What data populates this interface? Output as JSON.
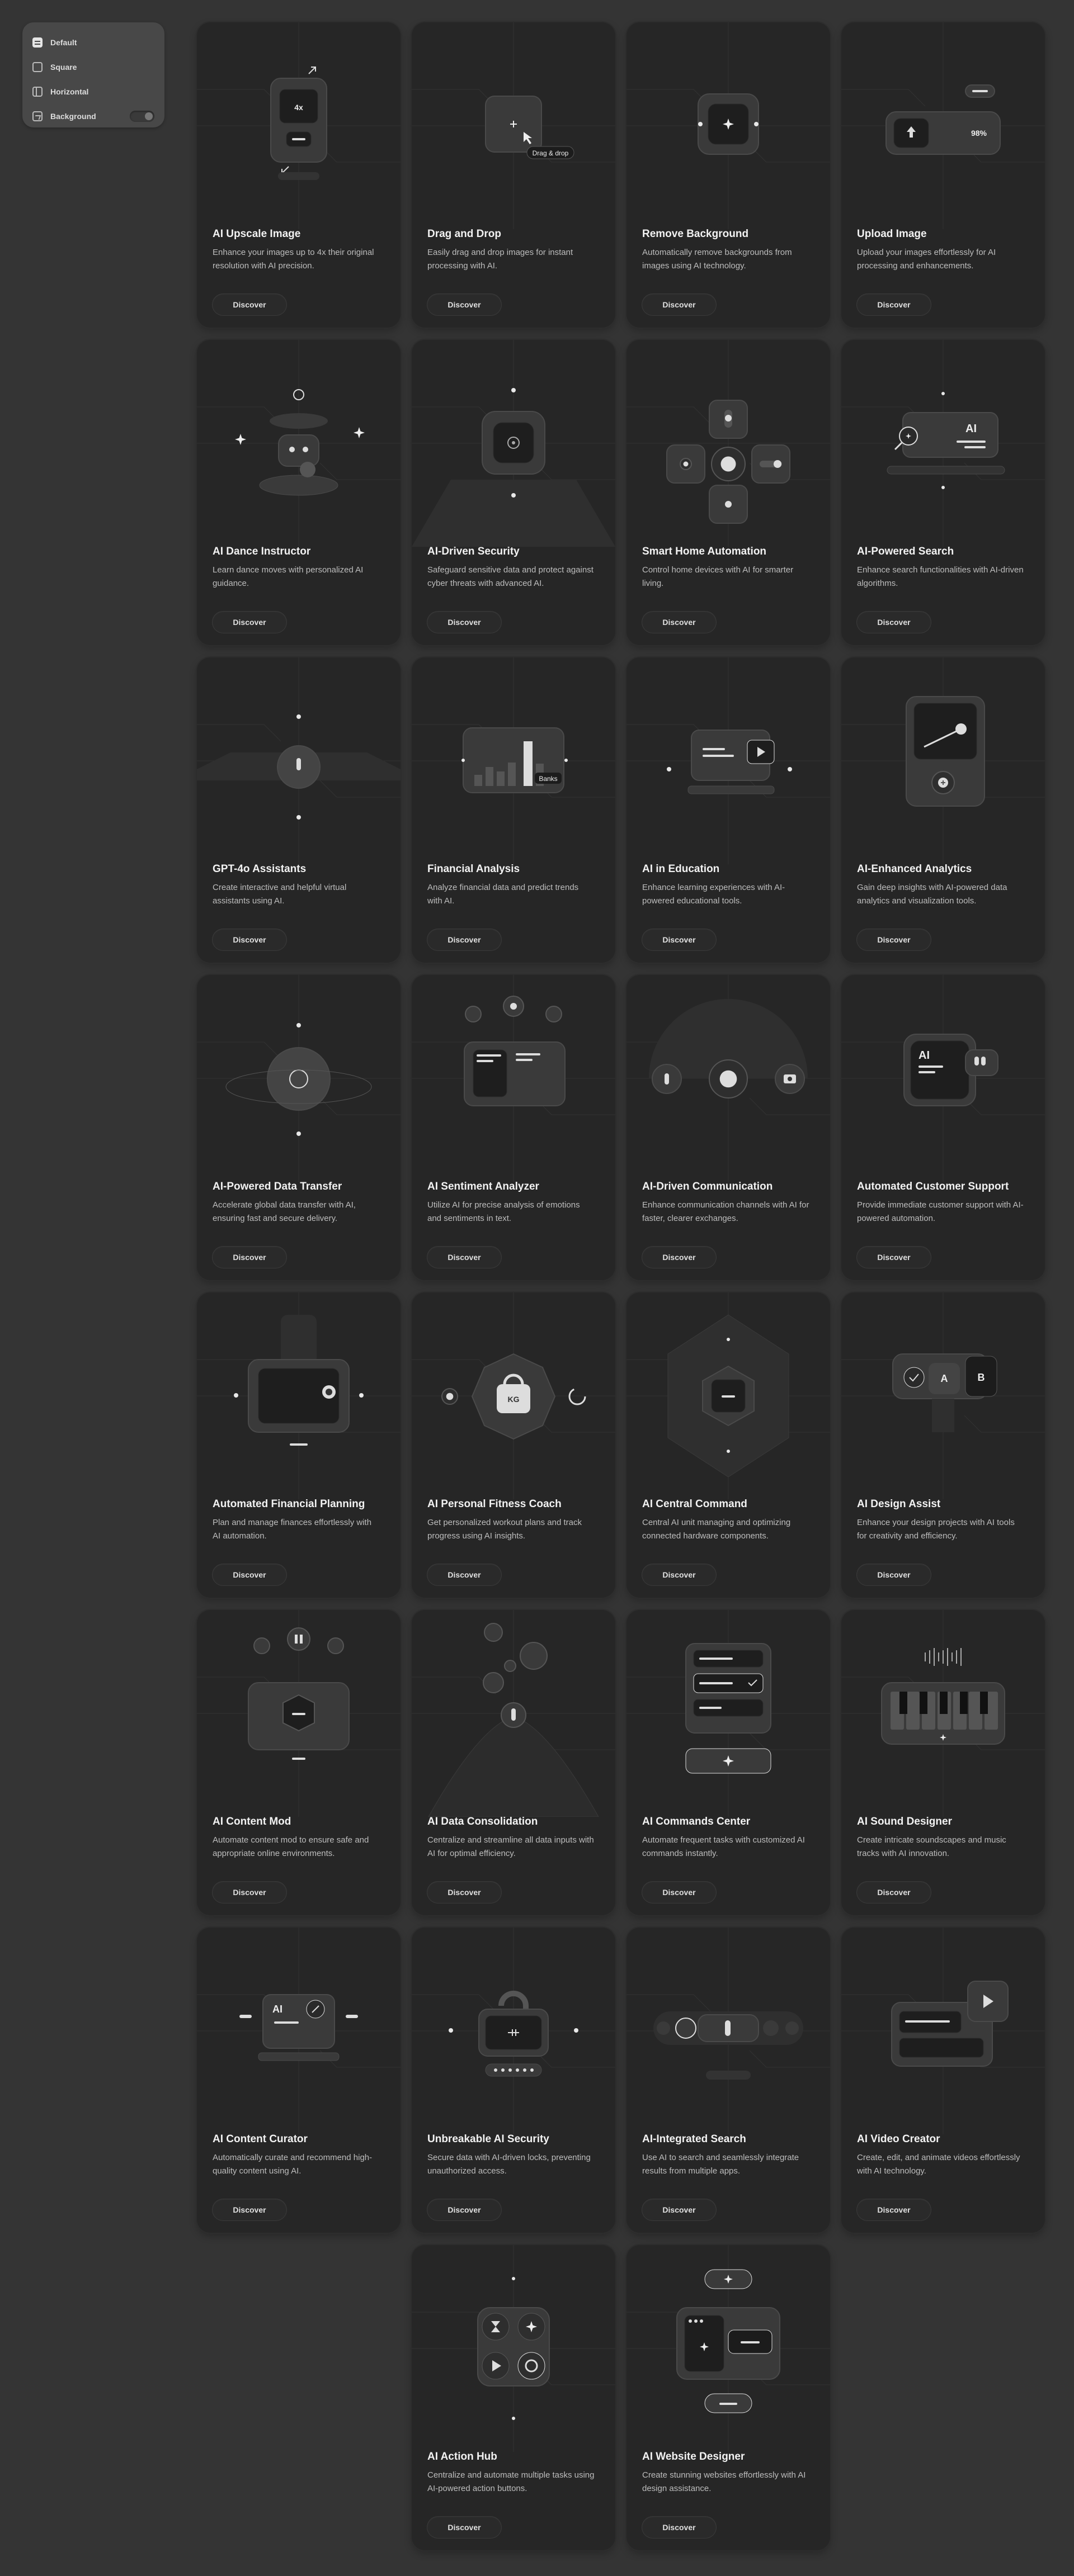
{
  "layout_options": [
    {
      "label": "Default",
      "icon": "list-icon",
      "active": true
    },
    {
      "label": "Square",
      "icon": "square-icon",
      "active": false
    },
    {
      "label": "Horizontal",
      "icon": "horizontal-layout-icon",
      "active": false
    },
    {
      "label": "Background",
      "icon": "image-icon",
      "active": false,
      "toggle": "off"
    }
  ],
  "colors": {
    "page_bg": "#343434",
    "card_bg": "#262626",
    "panel_bg": "#484848",
    "text": "#f2f2f2",
    "muted": "#bdbdbd"
  },
  "cards": [
    {
      "title": "AI Upscale Image",
      "description": "Enhance your images up to 4x their original resolution with AI precision.",
      "button": "Discover",
      "art": "upscale",
      "labels": [
        "4x"
      ]
    },
    {
      "title": "Drag and Drop",
      "description": "Easily drag and drop images for instant processing with AI.",
      "button": "Discover",
      "art": "dragdrop",
      "labels": [
        "Drag & drop"
      ]
    },
    {
      "title": "Remove Background",
      "description": "Automatically remove backgrounds from images using AI technology.",
      "button": "Discover",
      "art": "removebg",
      "labels": []
    },
    {
      "title": "Upload Image",
      "description": "Upload your images effortlessly for AI processing and enhancements.",
      "button": "Discover",
      "art": "upload",
      "labels": [
        "98%"
      ]
    },
    {
      "title": "AI Dance Instructor",
      "description": "Learn dance moves with personalized AI guidance.",
      "button": "Discover",
      "art": "dance",
      "labels": []
    },
    {
      "title": "AI-Driven Security",
      "description": "Safeguard sensitive data and protect against cyber threats with advanced AI.",
      "button": "Discover",
      "art": "security",
      "labels": []
    },
    {
      "title": "Smart Home Automation",
      "description": "Control home devices with AI for smarter living.",
      "button": "Discover",
      "art": "smarthome",
      "labels": []
    },
    {
      "title": "AI-Powered Search",
      "description": "Enhance search functionalities with AI-driven algorithms.",
      "button": "Discover",
      "art": "search",
      "labels": [
        "AI"
      ]
    },
    {
      "title": "GPT-4o Assistants",
      "description": "Create interactive and helpful virtual assistants using AI.",
      "button": "Discover",
      "art": "gpt",
      "labels": []
    },
    {
      "title": "Financial Analysis",
      "description": "Analyze financial data and predict trends with AI.",
      "button": "Discover",
      "art": "finance",
      "labels": [
        "Banks"
      ]
    },
    {
      "title": "AI in Education",
      "description": "Enhance learning experiences with AI-powered educational tools.",
      "button": "Discover",
      "art": "education",
      "labels": []
    },
    {
      "title": "AI-Enhanced Analytics",
      "description": "Gain deep insights with AI-powered data analytics and visualization tools.",
      "button": "Discover",
      "art": "analytics",
      "labels": []
    },
    {
      "title": "AI-Powered Data Transfer",
      "description": "Accelerate global data transfer with AI, ensuring fast and secure delivery.",
      "button": "Discover",
      "art": "transfer",
      "labels": []
    },
    {
      "title": "AI Sentiment Analyzer",
      "description": "Utilize AI for precise analysis of emotions and sentiments in text.",
      "button": "Discover",
      "art": "sentiment",
      "labels": []
    },
    {
      "title": "AI-Driven Communication",
      "description": "Enhance communication channels with AI for faster, clearer exchanges.",
      "button": "Discover",
      "art": "communication",
      "labels": []
    },
    {
      "title": "Automated Customer Support",
      "description": "Provide immediate customer support with AI-powered automation.",
      "button": "Discover",
      "art": "support",
      "labels": [
        "AI"
      ]
    },
    {
      "title": "Automated Financial Planning",
      "description": "Plan and manage finances effortlessly with AI automation.",
      "button": "Discover",
      "art": "planning",
      "labels": []
    },
    {
      "title": "AI Personal Fitness Coach",
      "description": "Get personalized workout plans and track progress using AI insights.",
      "button": "Discover",
      "art": "fitness",
      "labels": [
        "KG"
      ]
    },
    {
      "title": "AI Central Command",
      "description": "Central AI unit managing and optimizing connected hardware components.",
      "button": "Discover",
      "art": "central",
      "labels": []
    },
    {
      "title": "AI Design Assist",
      "description": "Enhance your design projects with AI tools for creativity and efficiency.",
      "button": "Discover",
      "art": "design",
      "labels": [
        "A",
        "B"
      ]
    },
    {
      "title": "AI Content Mod",
      "description": "Automate content mod to ensure safe and appropriate online environments.",
      "button": "Discover",
      "art": "contentmod",
      "labels": []
    },
    {
      "title": "AI Data Consolidation",
      "description": "Centralize and streamline all data inputs with AI for optimal efficiency.",
      "button": "Discover",
      "art": "consolidation",
      "labels": []
    },
    {
      "title": "AI Commands Center",
      "description": "Automate frequent tasks with customized AI commands instantly.",
      "button": "Discover",
      "art": "commands",
      "labels": []
    },
    {
      "title": "AI Sound Designer",
      "description": "Create intricate soundscapes and music tracks with AI innovation.",
      "button": "Discover",
      "art": "sound",
      "labels": []
    },
    {
      "title": "AI Content Curator",
      "description": "Automatically curate and recommend high-quality content using AI.",
      "button": "Discover",
      "art": "curator",
      "labels": [
        "AI"
      ]
    },
    {
      "title": "Unbreakable AI Security",
      "description": "Secure data with AI-driven locks, preventing unauthorized access.",
      "button": "Discover",
      "art": "lock",
      "labels": []
    },
    {
      "title": "AI-Integrated Search",
      "description": "Use AI to search and seamlessly integrate results from multiple apps.",
      "button": "Discover",
      "art": "integrated",
      "labels": []
    },
    {
      "title": "AI Video Creator",
      "description": "Create, edit, and animate videos effortlessly with AI technology.",
      "button": "Discover",
      "art": "video",
      "labels": []
    },
    {
      "title": "AI Action Hub",
      "description": "Centralize and automate multiple tasks using AI-powered action buttons.",
      "button": "Discover",
      "art": "actionhub",
      "labels": []
    },
    {
      "title": "AI Website Designer",
      "description": "Create stunning websites effortlessly with AI design assistance.",
      "button": "Discover",
      "art": "website",
      "labels": []
    }
  ]
}
